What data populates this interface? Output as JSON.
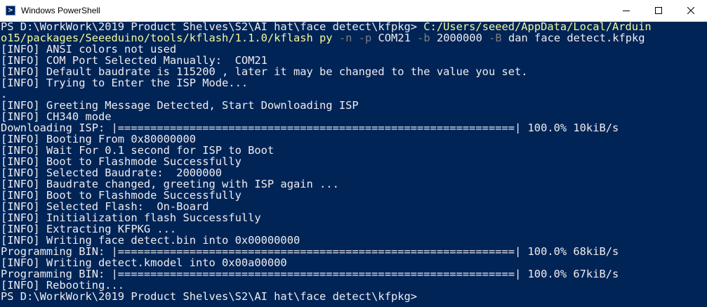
{
  "window": {
    "title": "Windows PowerShell",
    "icon": "powershell-icon"
  },
  "title_controls": {
    "minimize_icon": "minimize-icon",
    "maximize_icon": "maximize-icon",
    "close_icon": "close-icon"
  },
  "colors": {
    "background": "#012456",
    "text": "#eeedf0",
    "argument": "#7f7f7f",
    "executable": "#f3f99d"
  },
  "console": {
    "command": {
      "prompt": "PS D:\\WorkWork\\2019_Product_Shelves\\S2\\AI hat\\face_detect\\kfpkg> ",
      "exe_part1": "C:/Users/seeed/AppData/Local/Arduin",
      "exe_part2": "o15/packages/Seeeduino/tools/kflash/1.1.0/kflash_py",
      "flag_n": "-n",
      "flag_p": "-p",
      "port": "COM21",
      "flag_b": "-b",
      "baud": "2000000",
      "flag_B": "-B",
      "board": "dan",
      "file": "face_detect.kfpkg"
    },
    "lines": [
      "[INFO] ANSI colors not used",
      "[INFO] COM Port Selected Manually:  COM21",
      "[INFO] Default baudrate is 115200 , later it may be changed to the value you set.",
      "[INFO] Trying to Enter the ISP Mode...",
      ".",
      "[INFO] Greeting Message Detected, Start Downloading ISP",
      "[INFO] CH340 mode",
      "Downloading ISP: |=============================================================| 100.0% 10kiB/s",
      "[INFO] Booting From 0x80000000",
      "[INFO] Wait For 0.1 second for ISP to Boot",
      "[INFO] Boot to Flashmode Successfully",
      "[INFO] Selected Baudrate:  2000000",
      "[INFO] Baudrate changed, greeting with ISP again ...",
      "[INFO] Boot to Flashmode Successfully",
      "[INFO] Selected Flash:  On-Board",
      "[INFO] Initialization flash Successfully",
      "[INFO] Extracting KFPKG ...",
      "[INFO] Writing face_detect.bin into 0x00000000",
      "Programming BIN: |=============================================================| 100.0% 68kiB/s",
      "[INFO] Writing detect.kmodel into 0x00a00000",
      "Programming BIN: |=============================================================| 100.0% 67kiB/s",
      "[INFO] Rebooting..."
    ],
    "final_prompt": "PS D:\\WorkWork\\2019_Product_Shelves\\S2\\AI hat\\face_detect\\kfpkg>"
  }
}
